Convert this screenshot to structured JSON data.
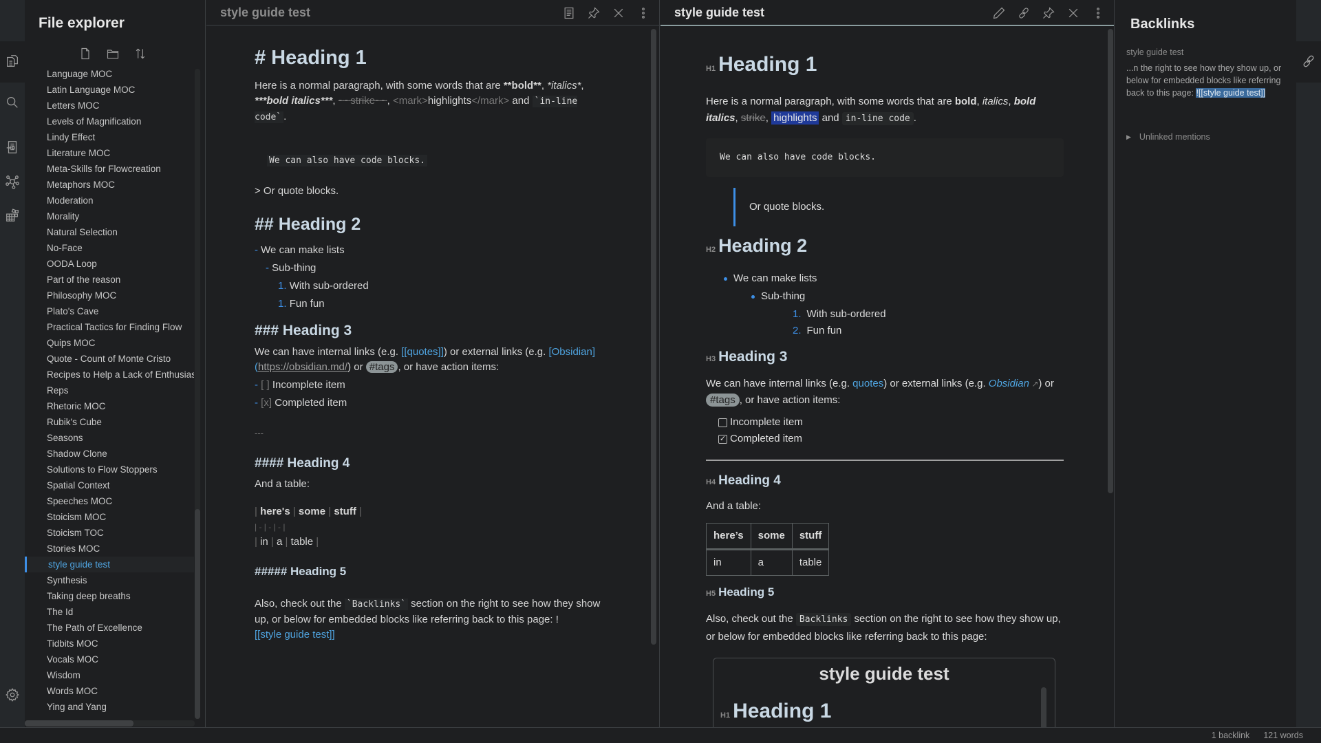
{
  "sidebar": {
    "title": "File explorer",
    "tools": [
      "new-note",
      "new-folder",
      "sort"
    ],
    "files": [
      "Language MOC",
      "Latin Language MOC",
      "Letters MOC",
      "Levels of Magnification",
      "Lindy Effect",
      "Literature MOC",
      "Meta-Skills for Flowcreation",
      "Metaphors MOC",
      "Moderation",
      "Morality",
      "Natural Selection",
      "No-Face",
      "OODA Loop",
      "Part of the reason",
      "Philosophy MOC",
      "Plato's Cave",
      "Practical Tactics for Finding Flow",
      "Quips MOC",
      "Quote - Count of Monte Cristo",
      "Recipes to Help a Lack of Enthusiasm",
      "Reps",
      "Rhetoric MOC",
      "Rubik's Cube",
      "Seasons",
      "Shadow Clone",
      "Solutions to Flow Stoppers",
      "Spatial Context",
      "Speeches MOC",
      "Stoicism MOC",
      "Stoicism TOC",
      "Stories MOC",
      "style guide test",
      "Synthesis",
      "Taking deep breaths",
      "The Id",
      "The Path of Excellence",
      "Tidbits MOC",
      "Vocals MOC",
      "Wisdom",
      "Words MOC",
      "Ying and Yang"
    ],
    "active_file": "style guide test"
  },
  "ribbon": [
    "files-icon",
    "search-icon",
    "import-icon",
    "graph-icon",
    "plugins-icon",
    "settings-icon"
  ],
  "editor": {
    "title": "style guide test",
    "h1": "# Heading 1",
    "p1": {
      "a": "Here is a normal paragraph, with some words that are ",
      "bold_mark": "**",
      "bold": "bold",
      "sep1": ", ",
      "ital_mark": "*",
      "italics": "italics",
      "sep2": ",",
      "bi_mark": "***",
      "bold_italics": "bold italics",
      "sep3": ", ",
      "strike": "~~strike~~",
      "sep4": ",  ",
      "mark_open": "<mark>",
      "highlights": "highlights",
      "mark_close": "</mark>",
      "and": " and ",
      "code": "`in-line code`",
      "end": "."
    },
    "codeblock": "We can also have code blocks.",
    "quote": "> Or quote blocks.",
    "h2": "## Heading 2",
    "list": [
      {
        "marker": "-",
        "text": "We can make lists"
      },
      {
        "marker": "-",
        "text": "Sub-thing"
      },
      {
        "marker": "1.",
        "text": "With sub-ordered"
      },
      {
        "marker": "1.",
        "text": "Fun fun"
      }
    ],
    "h3": "### Heading 3",
    "p3": {
      "a": "We can have internal links (e.g. ",
      "internal": "[[quotes]]",
      "b": ") or external links (e.g. ",
      "external_label": "[Obsidian](",
      "external_url": "https://obsidian.md/",
      "c": ") or ",
      "tag": "#tags",
      "d": ", or have action items:"
    },
    "tasks": [
      {
        "marker": "-",
        "box": "[ ]",
        "text": "Incomplete item"
      },
      {
        "marker": "-",
        "box": "[x]",
        "text": "Completed item"
      }
    ],
    "hr": "---",
    "h4": "#### Heading 4",
    "table_intro": "And a table:",
    "table_rows": [
      [
        "here's",
        "some",
        "stuff"
      ],
      [
        "-",
        "-",
        "-"
      ],
      [
        "in",
        "a",
        "table"
      ]
    ],
    "h5": "##### Heading 5",
    "p5": {
      "a": "Also, check out the ",
      "code": "`Backlinks`",
      "b": " section on the right to see how they show up, or below for embedded blocks like referring back to this page: !",
      "link": "[[style guide test]]"
    }
  },
  "preview": {
    "title": "style guide test",
    "h1": {
      "level": "H1",
      "text": "Heading 1"
    },
    "p1": {
      "a": "Here is a normal paragraph, with some words that are ",
      "bold": "bold",
      "italics": "italics",
      "bold_italics": "bold italics",
      "strike": "strike",
      "highlights": "highlights",
      "and": " and ",
      "code": "in-line code",
      "end": "."
    },
    "codeblock": "We can also have code blocks.",
    "quote": "Or quote blocks.",
    "h2": {
      "level": "H2",
      "text": "Heading 2"
    },
    "list": [
      {
        "text": "We can make lists"
      },
      {
        "text": "Sub-thing"
      },
      {
        "num": "1.",
        "text": "With sub-ordered"
      },
      {
        "num": "2.",
        "text": "Fun fun"
      }
    ],
    "h3": {
      "level": "H3",
      "text": "Heading 3"
    },
    "p3": {
      "a": "We can have internal links (e.g. ",
      "internal": "quotes",
      "b": ") or external links (e.g. ",
      "external": "Obsidian",
      "c": ") or ",
      "tag": "#tags",
      "d": ", or have action items:"
    },
    "tasks": [
      {
        "checked": false,
        "text": "Incomplete item"
      },
      {
        "checked": true,
        "text": "Completed item"
      }
    ],
    "h4": {
      "level": "H4",
      "text": "Heading 4"
    },
    "table_intro": "And a table:",
    "table": {
      "headers": [
        "here’s",
        "some",
        "stuff"
      ],
      "rows": [
        [
          "in",
          "a",
          "table"
        ]
      ]
    },
    "h5": {
      "level": "H5",
      "text": "Heading 5"
    },
    "p5": {
      "a": "Also, check out the ",
      "code": "Backlinks",
      "b": " section on the right to see how they show up, or below for embedded blocks like referring back to this page:"
    },
    "embed": {
      "title": "style guide test",
      "h1": {
        "level": "H1",
        "text": "Heading 1"
      }
    }
  },
  "backlinks": {
    "title": "Backlinks",
    "file": "style guide test",
    "snippet_before": "...n the right to see how they show up, or below for embedded blocks like referring back to this page: ",
    "snippet_match": "![[style guide test]]",
    "unlinked": "Unlinked mentions"
  },
  "status": {
    "backlinks": "1 backlink",
    "words": "121 words"
  },
  "colors": {
    "accent": "#3d8fe6",
    "link": "#4fa4e0",
    "highlight": "#1f3a99",
    "background": "#1e1f21"
  }
}
